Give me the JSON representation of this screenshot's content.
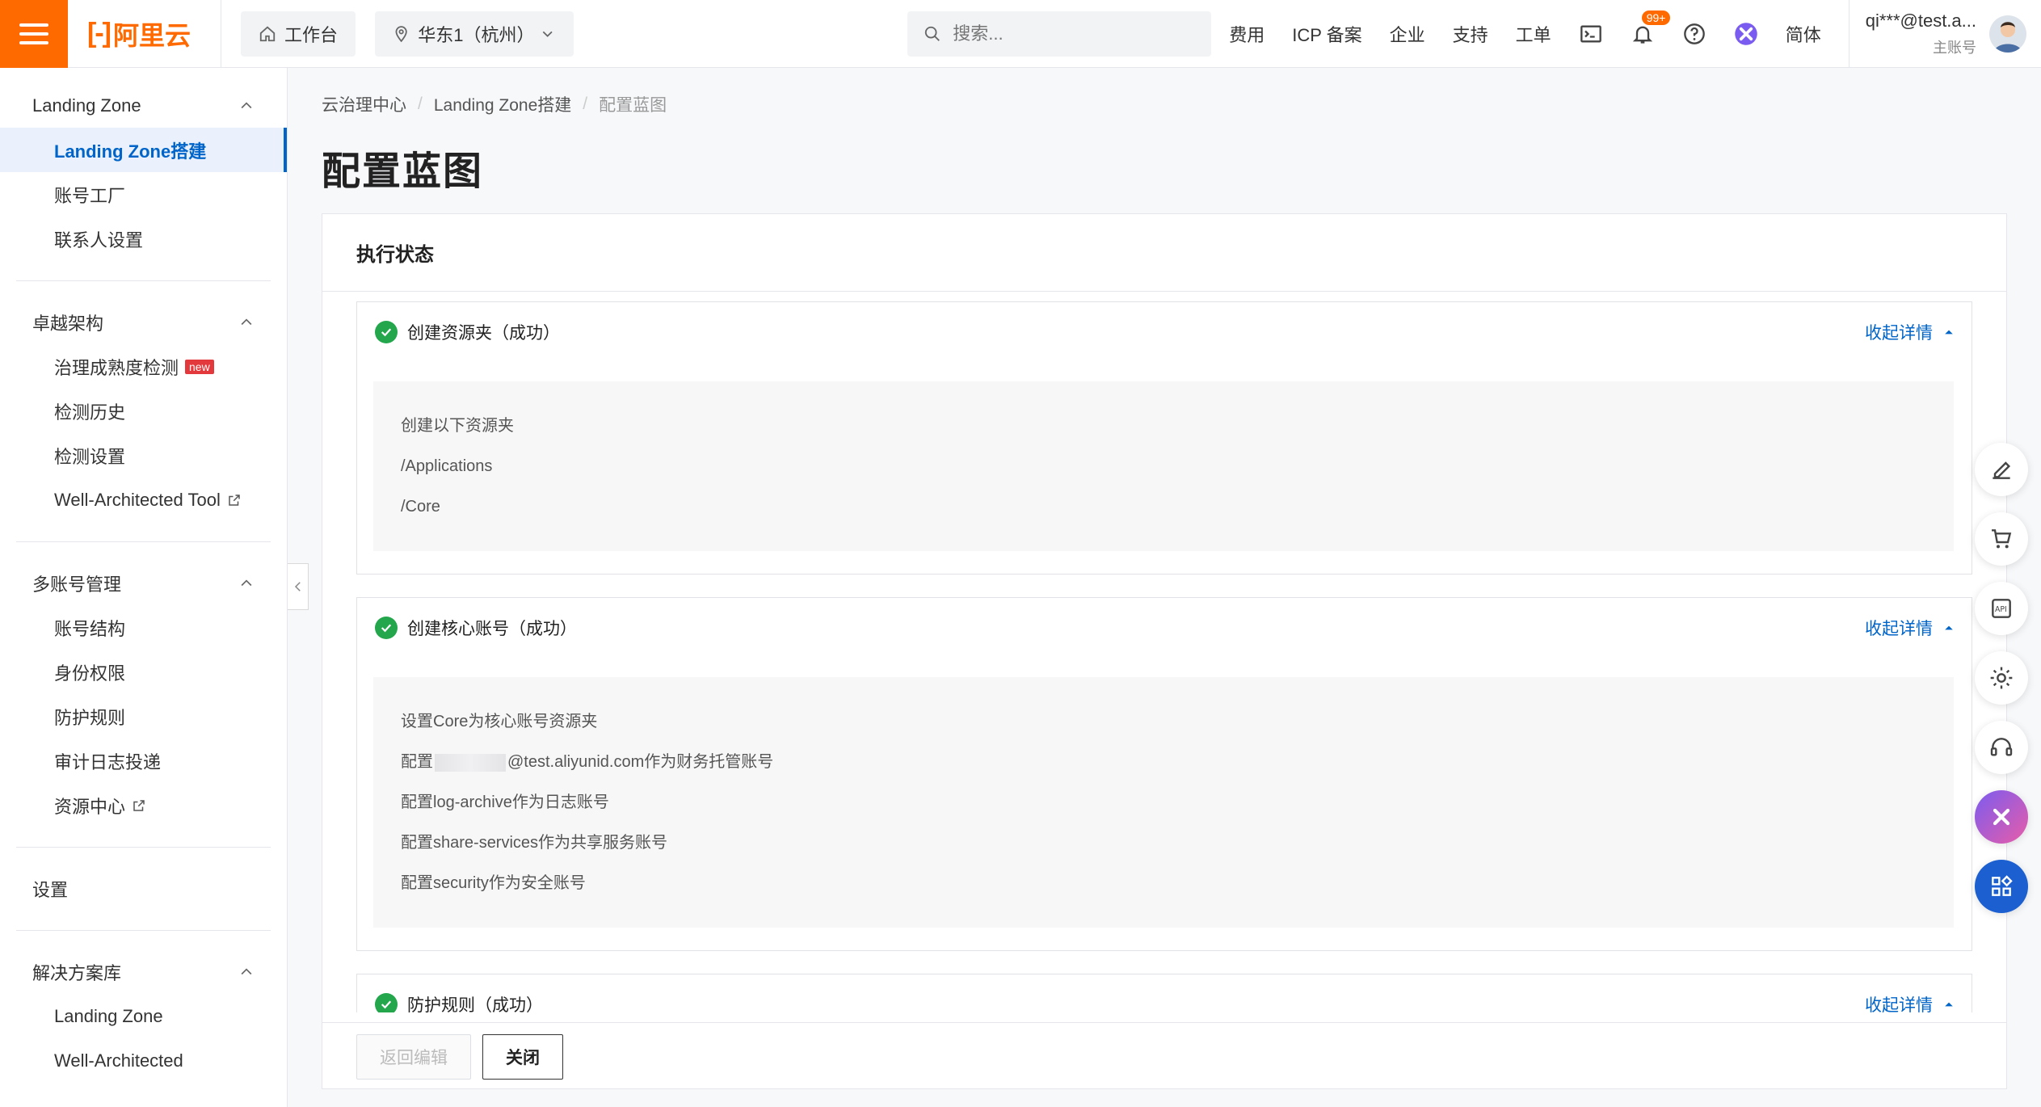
{
  "topbar": {
    "logo_text": "阿里云",
    "workbench": "工作台",
    "region": "华东1（杭州）",
    "search_placeholder": "搜索...",
    "links": [
      "费用",
      "ICP 备案",
      "企业",
      "支持",
      "工单"
    ],
    "notification_badge": "99+",
    "lang": "简体",
    "user_name": "qi***@test.a...",
    "user_role": "主账号"
  },
  "sidebar": {
    "groups": [
      {
        "title": "Landing Zone",
        "items": [
          {
            "label": "Landing Zone搭建",
            "active": true
          },
          {
            "label": "账号工厂"
          },
          {
            "label": "联系人设置"
          }
        ]
      },
      {
        "title": "卓越架构",
        "items": [
          {
            "label": "治理成熟度检测",
            "tag": "new"
          },
          {
            "label": "检测历史"
          },
          {
            "label": "检测设置"
          },
          {
            "label": "Well-Architected Tool",
            "external": true
          }
        ]
      },
      {
        "title": "多账号管理",
        "items": [
          {
            "label": "账号结构"
          },
          {
            "label": "身份权限"
          },
          {
            "label": "防护规则"
          },
          {
            "label": "审计日志投递"
          },
          {
            "label": "资源中心",
            "external": true
          }
        ]
      },
      {
        "title": "设置",
        "items": []
      },
      {
        "title": "解决方案库",
        "items": [
          {
            "label": "Landing Zone"
          },
          {
            "label": "Well-Architected"
          }
        ]
      }
    ]
  },
  "breadcrumb": [
    "云治理中心",
    "Landing Zone搭建",
    "配置蓝图"
  ],
  "page_title": "配置蓝图",
  "panel": {
    "title": "执行状态",
    "steps": [
      {
        "title": "创建资源夹（成功）",
        "toggle": "收起详情",
        "lines": [
          "创建以下资源夹",
          "/Applications",
          "/Core"
        ]
      },
      {
        "title": "创建核心账号（成功）",
        "toggle": "收起详情",
        "lines": [
          "设置Core为核心账号资源夹",
          "配置",
          "@test.aliyunid.com作为财务托管账号",
          "配置log-archive作为日志账号",
          "配置share-services作为共享服务账号",
          "配置security作为安全账号"
        ]
      },
      {
        "title": "防护规则（成功）",
        "toggle": "收起详情",
        "lines": []
      }
    ],
    "buttons": {
      "back": "返回编辑",
      "close": "关闭"
    }
  },
  "colors": {
    "brand": "#ff6a00",
    "link": "#0064c8",
    "success": "#23a64c"
  }
}
